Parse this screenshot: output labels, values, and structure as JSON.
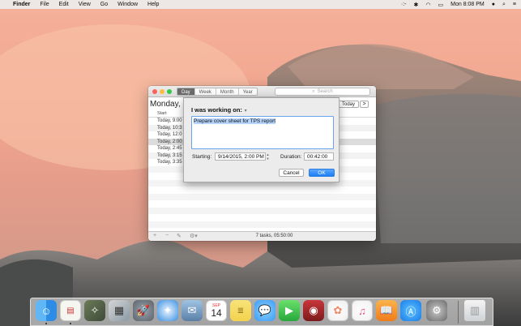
{
  "menubar": {
    "apple": "",
    "app": "Finder",
    "items": [
      "File",
      "Edit",
      "View",
      "Go",
      "Window",
      "Help"
    ],
    "status_icons": [
      "timing-icon",
      "bluetooth-icon",
      "wifi-icon",
      "battery-icon",
      "user-icon",
      "spotlight-icon",
      "menu-list-icon"
    ],
    "clock": "Mon 8:08 PM"
  },
  "window": {
    "tabs": [
      "Day",
      "Week",
      "Month",
      "Year"
    ],
    "active_tab": "Day",
    "search_placeholder": "Search",
    "day_title": "Monday, S",
    "today_label": "Today",
    "next_label": ">",
    "column_header": "Start",
    "rows": [
      "Today, 9:00",
      "Today, 10:3",
      "Today, 12:0",
      "Today, 2:00",
      "Today, 2:45",
      "Today, 3:15",
      "Today, 3:35"
    ],
    "selected_row": 3,
    "status": "7 tasks, 05:50:00",
    "bottom_icons": [
      "add-icon",
      "remove-icon",
      "edit-icon",
      "gear-icon"
    ]
  },
  "sheet": {
    "title": "I was working on:",
    "notes": "Prepare cover sheet for TPS report",
    "starting_label": "Starting:",
    "starting_value": "9/14/2015,   2:00 PM",
    "duration_label": "Duration:",
    "duration_value": "00:42:00",
    "cancel_label": "Cancel",
    "ok_label": "OK"
  },
  "dock": {
    "items": [
      "finder",
      "calendar-notes",
      "preview",
      "photos-slides",
      "launchpad",
      "safari",
      "mail",
      "calendar",
      "notes",
      "messages",
      "facetime",
      "photo-booth",
      "photos",
      "itunes",
      "ibooks",
      "app-store",
      "system-preferences",
      "trash"
    ],
    "calendar_month": "SEP",
    "calendar_day": "14"
  }
}
